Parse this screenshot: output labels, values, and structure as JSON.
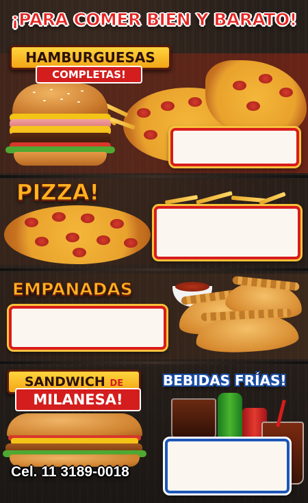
{
  "headline": "¡PARA COMER BIEN Y BARATO!",
  "sections": {
    "hamburguesas": {
      "title": "HAMBURGUESAS",
      "subtitle": "COMPLETAS!"
    },
    "pizza": {
      "title": "PIZZA!"
    },
    "empanadas": {
      "title": "EMPANADAS"
    },
    "sandwich": {
      "title_line1": "SANDWICH",
      "title_de": "DE",
      "title_line2": "MILANESA!"
    },
    "bebidas": {
      "title": "BEBIDAS FRÍAS!"
    }
  },
  "contact": {
    "phone": "Cel. 11 3189-0018"
  },
  "colors": {
    "red": "#d81c1c",
    "yellow": "#f7c23a",
    "blue": "#1d56b8",
    "cream": "#fbf7f0"
  }
}
